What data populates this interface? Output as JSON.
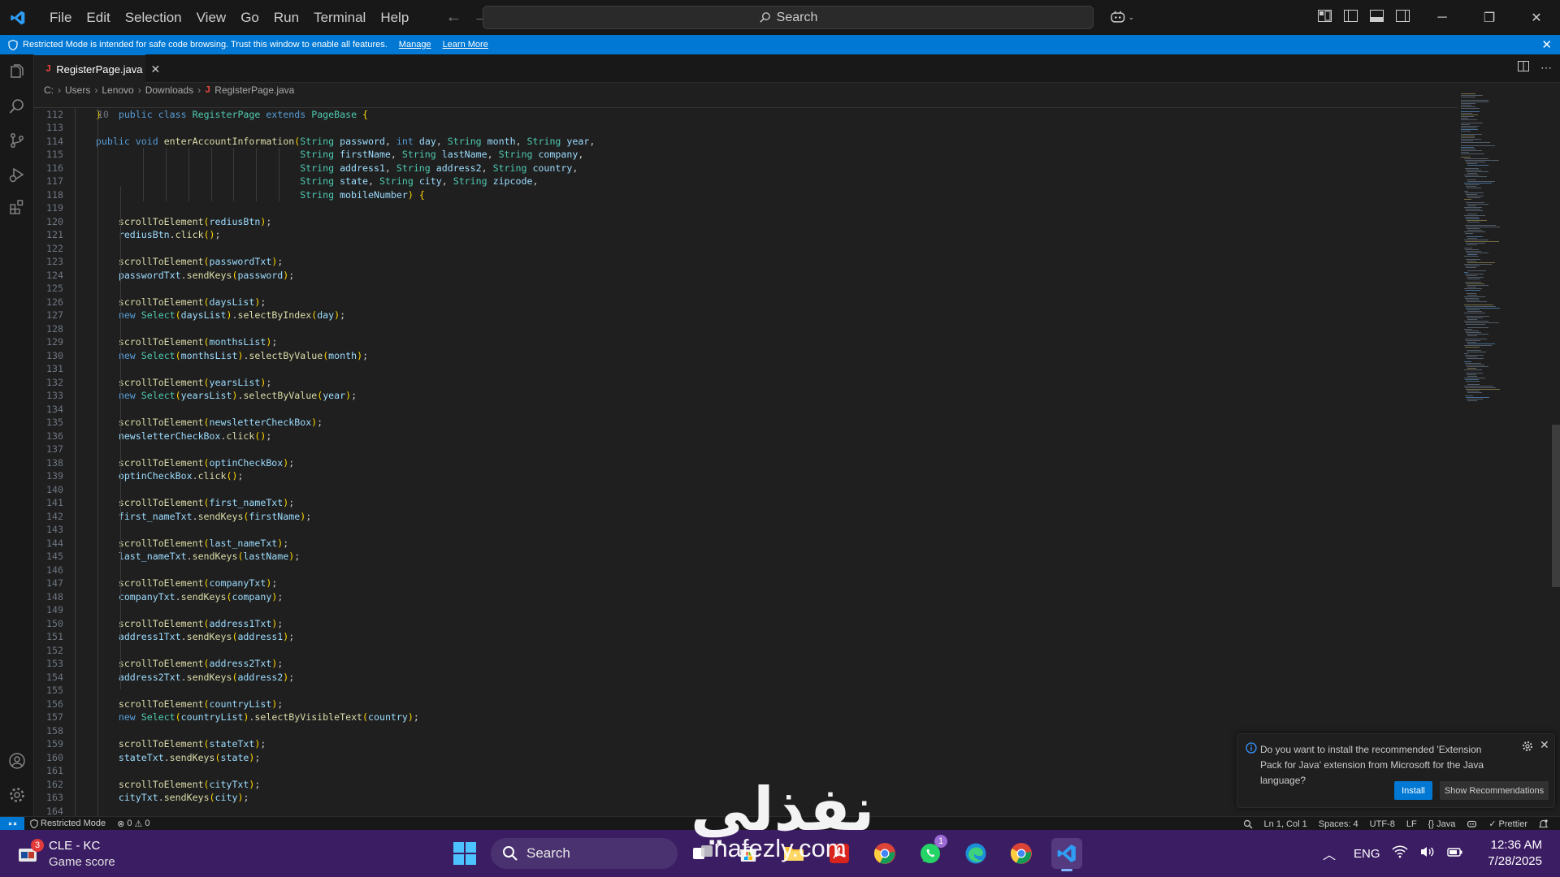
{
  "titlebar": {
    "menu": [
      "File",
      "Edit",
      "Selection",
      "View",
      "Go",
      "Run",
      "Terminal",
      "Help"
    ],
    "search_label": "Search"
  },
  "banner": {
    "text": "Restricted Mode is intended for safe code browsing. Trust this window to enable all features.",
    "manage": "Manage",
    "learn_more": "Learn More"
  },
  "tab": {
    "name": "RegisterPage.java",
    "icon_letter": "J"
  },
  "breadcrumb": {
    "items": [
      "C:",
      "Users",
      "Lenovo",
      "Downloads",
      "RegisterPage.java"
    ],
    "icon_letter": "J"
  },
  "editor": {
    "sticky": {
      "line_number": "10",
      "text": "public class RegisterPage extends PageBase {"
    },
    "lines": [
      {
        "n": "112",
        "t": "    }"
      },
      {
        "n": "113",
        "t": ""
      },
      {
        "n": "114",
        "t": "    public void enterAccountInformation(String password, int day, String month, String year,"
      },
      {
        "n": "115",
        "t": "                                        String firstName, String lastName, String company,"
      },
      {
        "n": "116",
        "t": "                                        String address1, String address2, String country,"
      },
      {
        "n": "117",
        "t": "                                        String state, String city, String zipcode,"
      },
      {
        "n": "118",
        "t": "                                        String mobileNumber) {"
      },
      {
        "n": "119",
        "t": ""
      },
      {
        "n": "120",
        "t": "        scrollToElement(rediusBtn);"
      },
      {
        "n": "121",
        "t": "        rediusBtn.click();"
      },
      {
        "n": "122",
        "t": ""
      },
      {
        "n": "123",
        "t": "        scrollToElement(passwordTxt);"
      },
      {
        "n": "124",
        "t": "        passwordTxt.sendKeys(password);"
      },
      {
        "n": "125",
        "t": ""
      },
      {
        "n": "126",
        "t": "        scrollToElement(daysList);"
      },
      {
        "n": "127",
        "t": "        new Select(daysList).selectByIndex(day);"
      },
      {
        "n": "128",
        "t": ""
      },
      {
        "n": "129",
        "t": "        scrollToElement(monthsList);"
      },
      {
        "n": "130",
        "t": "        new Select(monthsList).selectByValue(month);"
      },
      {
        "n": "131",
        "t": ""
      },
      {
        "n": "132",
        "t": "        scrollToElement(yearsList);"
      },
      {
        "n": "133",
        "t": "        new Select(yearsList).selectByValue(year);"
      },
      {
        "n": "134",
        "t": ""
      },
      {
        "n": "135",
        "t": "        scrollToElement(newsletterCheckBox);"
      },
      {
        "n": "136",
        "t": "        newsletterCheckBox.click();"
      },
      {
        "n": "137",
        "t": ""
      },
      {
        "n": "138",
        "t": "        scrollToElement(optinCheckBox);"
      },
      {
        "n": "139",
        "t": "        optinCheckBox.click();"
      },
      {
        "n": "140",
        "t": ""
      },
      {
        "n": "141",
        "t": "        scrollToElement(first_nameTxt);"
      },
      {
        "n": "142",
        "t": "        first_nameTxt.sendKeys(firstName);"
      },
      {
        "n": "143",
        "t": ""
      },
      {
        "n": "144",
        "t": "        scrollToElement(last_nameTxt);"
      },
      {
        "n": "145",
        "t": "        last_nameTxt.sendKeys(lastName);"
      },
      {
        "n": "146",
        "t": ""
      },
      {
        "n": "147",
        "t": "        scrollToElement(companyTxt);"
      },
      {
        "n": "148",
        "t": "        companyTxt.sendKeys(company);"
      },
      {
        "n": "149",
        "t": ""
      },
      {
        "n": "150",
        "t": "        scrollToElement(address1Txt);"
      },
      {
        "n": "151",
        "t": "        address1Txt.sendKeys(address1);"
      },
      {
        "n": "152",
        "t": ""
      },
      {
        "n": "153",
        "t": "        scrollToElement(address2Txt);"
      },
      {
        "n": "154",
        "t": "        address2Txt.sendKeys(address2);"
      },
      {
        "n": "155",
        "t": ""
      },
      {
        "n": "156",
        "t": "        scrollToElement(countryList);"
      },
      {
        "n": "157",
        "t": "        new Select(countryList).selectByVisibleText(country);"
      },
      {
        "n": "158",
        "t": ""
      },
      {
        "n": "159",
        "t": "        scrollToElement(stateTxt);"
      },
      {
        "n": "160",
        "t": "        stateTxt.sendKeys(state);"
      },
      {
        "n": "161",
        "t": ""
      },
      {
        "n": "162",
        "t": "        scrollToElement(cityTxt);"
      },
      {
        "n": "163",
        "t": "        cityTxt.sendKeys(city);"
      },
      {
        "n": "164",
        "t": ""
      }
    ]
  },
  "notification": {
    "text": "Do you want to install the recommended 'Extension Pack for Java' extension from Microsoft for the Java language?",
    "install": "Install",
    "show": "Show Recommendations"
  },
  "statusbar": {
    "restricted": "Restricted Mode",
    "errors": "0",
    "warnings": "0",
    "position": "Ln 1, Col 1",
    "spaces": "Spaces: 4",
    "encoding": "UTF-8",
    "eol": "LF",
    "language": "{} Java",
    "prettier": "Prettier"
  },
  "taskbar": {
    "weather_title": "CLE - KC",
    "weather_sub": "Game score",
    "weather_badge": "3",
    "search": "Search",
    "whatsapp_badge": "1",
    "lang": "ENG",
    "time": "12:36 AM",
    "date": "7/28/2025"
  },
  "watermark": {
    "arabic": "نفذلي",
    "url": "nafezly.com"
  },
  "colors": {
    "accent": "#0078d4",
    "taskbar": "#3b1d63",
    "editor_bg": "#1f1f1f",
    "chrome_bg": "#181818"
  }
}
